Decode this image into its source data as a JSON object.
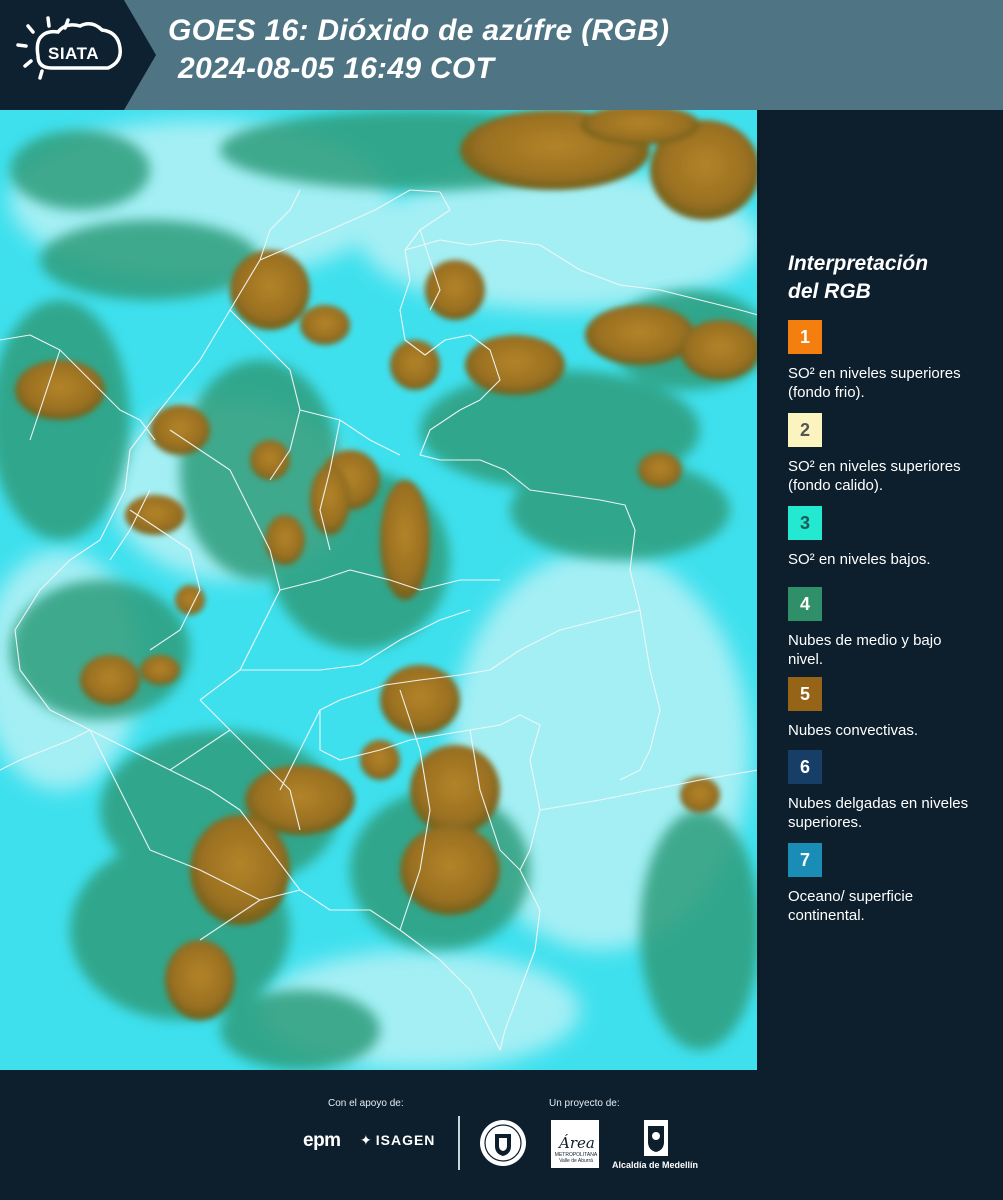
{
  "header": {
    "logo_text": "SIATA",
    "title_line1": "GOES 16: Dióxido de azúfre (RGB)",
    "title_line2": "2024-08-05 16:49 COT"
  },
  "colors": {
    "header_bg": "#4f7585",
    "page_bg": "#0d1f2d",
    "map_background_cyan": "#3fe0ee",
    "convective_brown": "#a27a1c",
    "low_cloud_green": "#2f9d7c"
  },
  "legend": {
    "title_line1": "Interpretación",
    "title_line2": "del RGB",
    "items": [
      {
        "number": "1",
        "label": "SO² en niveles superiores (fondo frio).",
        "color": "#f47e0e",
        "text_color": "#ffffff"
      },
      {
        "number": "2",
        "label": "SO² en niveles superiores (fondo calido).",
        "color": "#fbf4bf",
        "text_color": "#555555"
      },
      {
        "number": "3",
        "label": "SO² en niveles bajos.",
        "color": "#22e9cf",
        "text_color": "#1b5a55"
      },
      {
        "number": "4",
        "label": "Nubes de medio y bajo nivel.",
        "color": "#2f8f69",
        "text_color": "#ffffff"
      },
      {
        "number": "5",
        "label": "Nubes convectivas.",
        "color": "#966417",
        "text_color": "#ffffff"
      },
      {
        "number": "6",
        "label": "Nubes delgadas en niveles superiores.",
        "color": "#163e67",
        "text_color": "#ffffff"
      },
      {
        "number": "7",
        "label": "Oceano/ superficie continental.",
        "color": "#1a8db7",
        "text_color": "#ffffff"
      }
    ]
  },
  "footer": {
    "support_label": "Con el apoyo de:",
    "project_label": "Un proyecto de:",
    "sponsor_1": "epm",
    "sponsor_2": "ISAGEN",
    "partner_area_word": "Área",
    "partner_area_sub": "METROPOLITANA Valle de Aburrá",
    "partner_alcaldia": "Alcaldía de Medellín"
  }
}
